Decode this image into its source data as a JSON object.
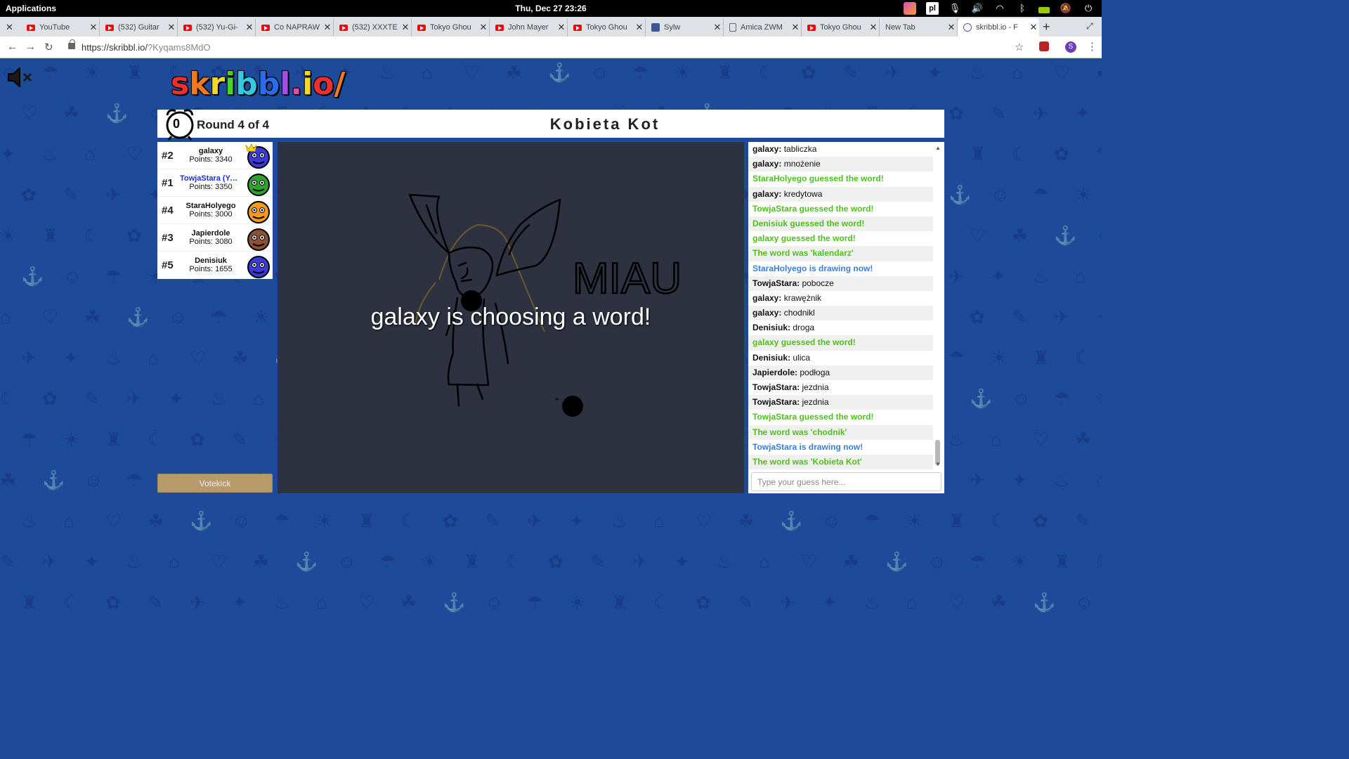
{
  "os": {
    "apps_label": "Applications",
    "clock": "Thu, Dec 27   23:26",
    "lang": "pl"
  },
  "browser": {
    "tabs": [
      {
        "title": "YouTube",
        "icon": "youtube-icon"
      },
      {
        "title": "(532) Guitar",
        "icon": "youtube-icon"
      },
      {
        "title": "(532) Yu-Gi-",
        "icon": "youtube-icon"
      },
      {
        "title": "Co NAPRAW",
        "icon": "youtube-icon"
      },
      {
        "title": "(532) XXXTE",
        "icon": "youtube-icon"
      },
      {
        "title": "Tokyo Ghou",
        "icon": "youtube-icon"
      },
      {
        "title": "John Mayer",
        "icon": "youtube-icon"
      },
      {
        "title": "Tokyo Ghou",
        "icon": "youtube-icon"
      },
      {
        "title": "Sylw",
        "icon": "facebook-icon"
      },
      {
        "title": "Amica ZWM",
        "icon": "document-icon"
      },
      {
        "title": "Tokyo Ghou",
        "icon": "youtube-icon"
      },
      {
        "title": "New Tab",
        "icon": "none"
      },
      {
        "title": "skribbl.io - F",
        "icon": "skribbl-icon"
      }
    ],
    "url_host": "https://skribbl.io/",
    "url_path": "?Kyqams8MdO",
    "profile_initial": "S"
  },
  "game": {
    "logo": "skribbl.io",
    "timer": "0",
    "round": "Round 4 of 4",
    "word": "Kobieta Kot",
    "overlay": "galaxy is choosing a word!",
    "canvas_text": "MIAU",
    "votekick": "Votekick",
    "players": [
      {
        "rank": "#2",
        "name": "galaxy",
        "points": "Points: 3340",
        "color": "#3a3ad8",
        "crown": true,
        "me": false
      },
      {
        "rank": "#1",
        "name": "TowjaStara (You)",
        "points": "Points: 3350",
        "color": "#2fa32f",
        "crown": false,
        "me": true
      },
      {
        "rank": "#4",
        "name": "StaraHolyego",
        "points": "Points: 3000",
        "color": "#f59a1a",
        "crown": false,
        "me": false
      },
      {
        "rank": "#3",
        "name": "Japierdole",
        "points": "Points: 3080",
        "color": "#8a5232",
        "crown": false,
        "me": false
      },
      {
        "rank": "#5",
        "name": "Denisiuk",
        "points": "Points: 1655",
        "color": "#3a3ad8",
        "crown": false,
        "me": false
      }
    ]
  },
  "chat": {
    "messages": [
      {
        "user": "galaxy:",
        "text": " tabliczka",
        "type": "normal"
      },
      {
        "user": "galaxy:",
        "text": " mnożenie",
        "type": "normal"
      },
      {
        "user": "",
        "text": "StaraHolyego guessed the word!",
        "type": "green"
      },
      {
        "user": "galaxy:",
        "text": " kredytowa",
        "type": "normal"
      },
      {
        "user": "",
        "text": "TowjaStara guessed the word!",
        "type": "green"
      },
      {
        "user": "",
        "text": "Denisiuk guessed the word!",
        "type": "green"
      },
      {
        "user": "",
        "text": "galaxy guessed the word!",
        "type": "green"
      },
      {
        "user": "",
        "text": "The word was 'kalendarz'",
        "type": "green"
      },
      {
        "user": "",
        "text": "StaraHolyego is drawing now!",
        "type": "blue"
      },
      {
        "user": "TowjaStara:",
        "text": " pobocze",
        "type": "normal"
      },
      {
        "user": "galaxy:",
        "text": " krawężnik",
        "type": "normal"
      },
      {
        "user": "galaxy:",
        "text": " chodnikl",
        "type": "normal"
      },
      {
        "user": "Denisiuk:",
        "text": " droga",
        "type": "normal"
      },
      {
        "user": "",
        "text": "galaxy guessed the word!",
        "type": "green"
      },
      {
        "user": "Denisiuk:",
        "text": " ulica",
        "type": "normal"
      },
      {
        "user": "Japierdole:",
        "text": " podłoga",
        "type": "normal"
      },
      {
        "user": "TowjaStara:",
        "text": " jezdnia",
        "type": "normal"
      },
      {
        "user": "TowjaStara:",
        "text": " jezdnia",
        "type": "normal"
      },
      {
        "user": "",
        "text": "TowjaStara guessed the word!",
        "type": "green"
      },
      {
        "user": "",
        "text": "The word was 'chodnik'",
        "type": "green"
      },
      {
        "user": "",
        "text": "TowjaStara is drawing now!",
        "type": "blue"
      },
      {
        "user": "",
        "text": "The word was 'Kobieta Kot'",
        "type": "green"
      }
    ],
    "input_placeholder": "Type your guess here..."
  }
}
